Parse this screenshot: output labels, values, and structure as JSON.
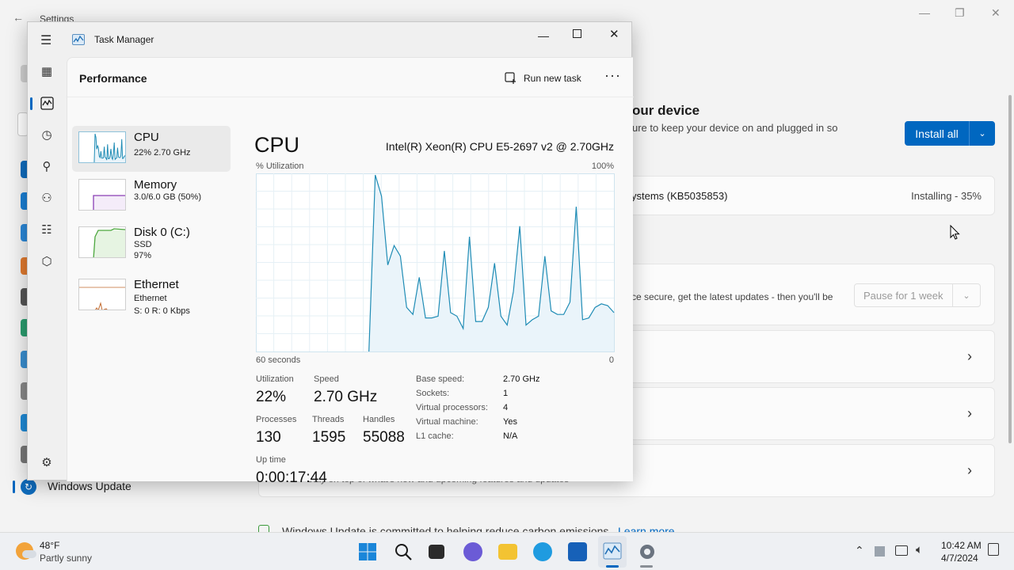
{
  "settings": {
    "title": "Settings",
    "heading_partial": "our device",
    "subtext_partial": "ure to keep your device on and plugged in so",
    "install_all_label": "Install all",
    "update_row": {
      "name_partial": "ystems (KB5035853)",
      "status": "Installing - 35%"
    },
    "pause_desc_partial": "ce secure, get the latest updates - then you'll be",
    "pause_button_label": "Pause for 1 week",
    "bottom_card_sub_partial": "Stay on top of what's new and upcoming features and updates",
    "nav_active_label": "Windows Update",
    "footer_text": "Windows Update is committed to helping reduce carbon emissions.",
    "footer_link": "Learn more"
  },
  "task_manager": {
    "title": "Task Manager",
    "page_title": "Performance",
    "run_new_task_label": "Run new task",
    "resources": [
      {
        "name": "CPU",
        "sub1": "22% 2.70 GHz",
        "sub2": "",
        "sub3": ""
      },
      {
        "name": "Memory",
        "sub1": "3.0/6.0 GB (50%)",
        "sub2": "",
        "sub3": ""
      },
      {
        "name": "Disk 0 (C:)",
        "sub1": "SSD",
        "sub2": "97%",
        "sub3": ""
      },
      {
        "name": "Ethernet",
        "sub1": "Ethernet",
        "sub2": "S: 0 R: 0 Kbps",
        "sub3": ""
      }
    ],
    "cpu": {
      "heading": "CPU",
      "model": "Intel(R) Xeon(R) CPU E5-2697 v2 @ 2.70GHz",
      "graph_label": "% Utilization",
      "graph_max": "100%",
      "graph_time": "60 seconds",
      "graph_min": "0",
      "utilization_label": "Utilization",
      "utilization": "22%",
      "speed_label": "Speed",
      "speed": "2.70 GHz",
      "processes_label": "Processes",
      "processes": "130",
      "threads_label": "Threads",
      "threads": "1595",
      "handles_label": "Handles",
      "handles": "55088",
      "uptime_label": "Up time",
      "uptime": "0:00:17:44",
      "specs": [
        {
          "k": "Base speed:",
          "v": "2.70 GHz"
        },
        {
          "k": "Sockets:",
          "v": "1"
        },
        {
          "k": "Virtual processors:",
          "v": "4"
        },
        {
          "k": "Virtual machine:",
          "v": "Yes"
        },
        {
          "k": "L1 cache:",
          "v": "N/A"
        }
      ],
      "history": [
        0,
        0,
        0,
        0,
        0,
        0,
        0,
        0,
        0,
        0,
        0,
        0,
        0,
        0,
        0,
        0,
        0,
        0,
        0,
        100,
        88,
        49,
        60,
        54,
        25,
        21,
        42,
        19,
        19,
        20,
        57,
        22,
        20,
        13,
        65,
        17,
        17,
        25,
        50,
        20,
        15,
        34,
        71,
        15,
        18,
        20,
        54,
        23,
        21,
        21,
        28,
        82,
        18,
        19,
        25,
        27,
        26,
        22
      ]
    }
  },
  "taskbar": {
    "weather_temp": "48°F",
    "weather_desc": "Partly sunny",
    "time": "10:42 AM",
    "date": "4/7/2024"
  },
  "colors": {
    "accent": "#0067c0",
    "cpu_line": "#1f8cb5",
    "cpu_fill": "#eaf4fa",
    "memory_line": "#8a3fb5",
    "disk_line": "#4ca73e",
    "ethernet_line": "#c26a2e"
  }
}
